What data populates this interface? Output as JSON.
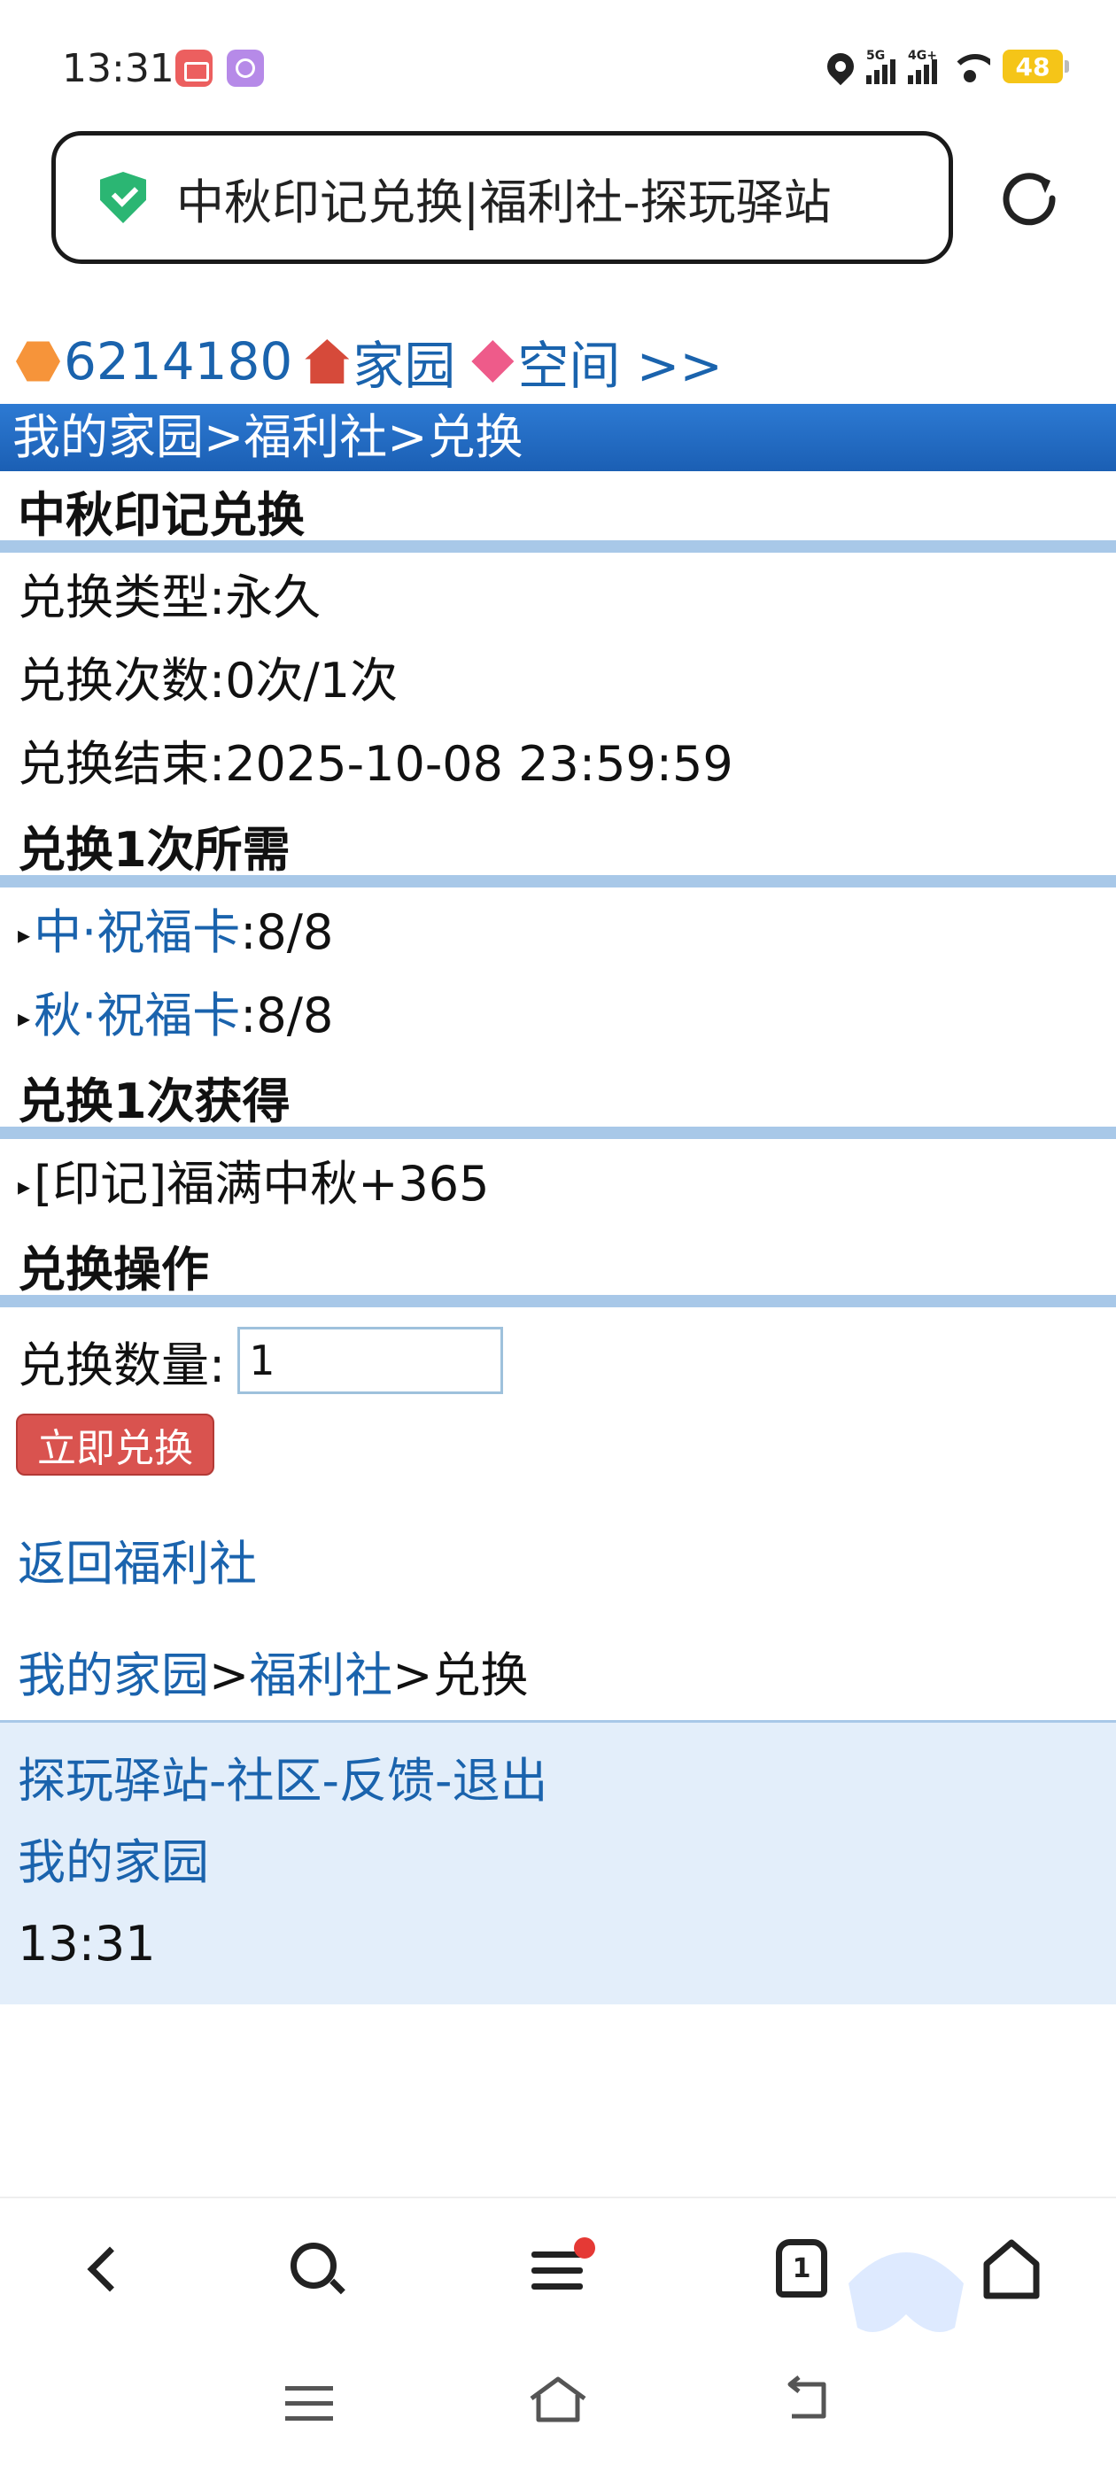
{
  "status_bar": {
    "time": "13:31",
    "net1": "5G",
    "net2": "4G+",
    "battery": "48"
  },
  "address_bar": {
    "title": "中秋印记兑换|福利社-探玩驿站"
  },
  "top_links": {
    "user_id": "6214180",
    "home": "家园",
    "space": "空间 >>"
  },
  "nav_title": "我的家园>福利社>兑换",
  "exchange": {
    "heading": "中秋印记兑换",
    "type": "兑换类型:永久",
    "count": "兑换次数:0次/1次",
    "end": "兑换结束:2025-10-08 23:59:59"
  },
  "requirements": {
    "heading": "兑换1次所需",
    "items": [
      {
        "name": "中·祝福卡",
        "qty": ":8/8"
      },
      {
        "name": "秋·祝福卡",
        "qty": ":8/8"
      }
    ]
  },
  "rewards": {
    "heading": "兑换1次获得",
    "items": [
      "[印记]福满中秋+365"
    ]
  },
  "operation": {
    "heading": "兑换操作",
    "qty_label": "兑换数量:",
    "qty_value": "1",
    "submit_label": "立即兑换"
  },
  "back_link": "返回福利社",
  "breadcrumb": {
    "home": "我的家园",
    "sep1": ">",
    "welfare": "福利社",
    "sep2": ">",
    "current": "兑换"
  },
  "footer": {
    "site": "探玩驿站",
    "sep": "-",
    "community": "社区",
    "feedback": "反馈",
    "logout": "退出",
    "my_home": "我的家园",
    "time": "13:31"
  },
  "toolbar": {
    "tabs_count": "1"
  },
  "colors": {
    "link": "#1a63ad",
    "nav_bar": "#1b5fb4",
    "divider": "#a8c8e8",
    "button": "#d9534f",
    "footer_bg": "#e3eefa"
  }
}
